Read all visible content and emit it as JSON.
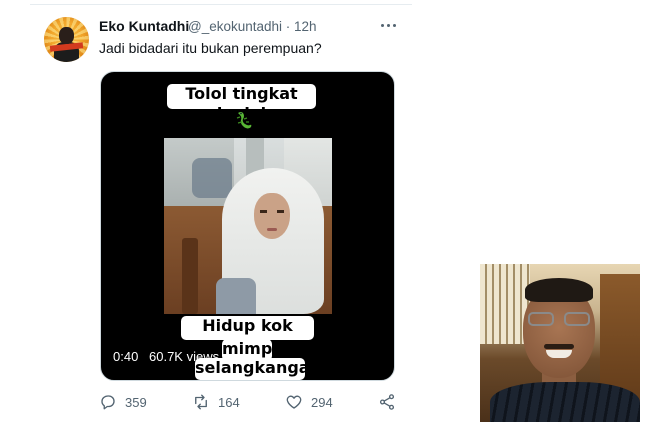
{
  "tweet": {
    "display_name": "Eko Kuntadhi",
    "handle_time": "@_ekokuntadhi · 12h",
    "text": "Jadi bidadari itu bukan perempuan?"
  },
  "video": {
    "caption_top": "Tolol tingkat kadal",
    "caption_bottom_1": "Hidup kok cuma",
    "caption_bottom_2": "mimpi",
    "caption_bottom_3": "selangkangan",
    "duration": "0:40",
    "views": "60.7K views"
  },
  "actions": {
    "reply_count": "359",
    "retweet_count": "164",
    "like_count": "294"
  },
  "icons": {
    "more": "more-horizontal-icon",
    "reply": "reply-icon",
    "retweet": "retweet-icon",
    "like": "heart-icon",
    "share": "share-icon",
    "emoji": "lizard-icon"
  },
  "colors": {
    "text_primary": "#0f1419",
    "text_secondary": "#536471",
    "video_bg": "#000000",
    "caption_bg": "#ffffff"
  }
}
